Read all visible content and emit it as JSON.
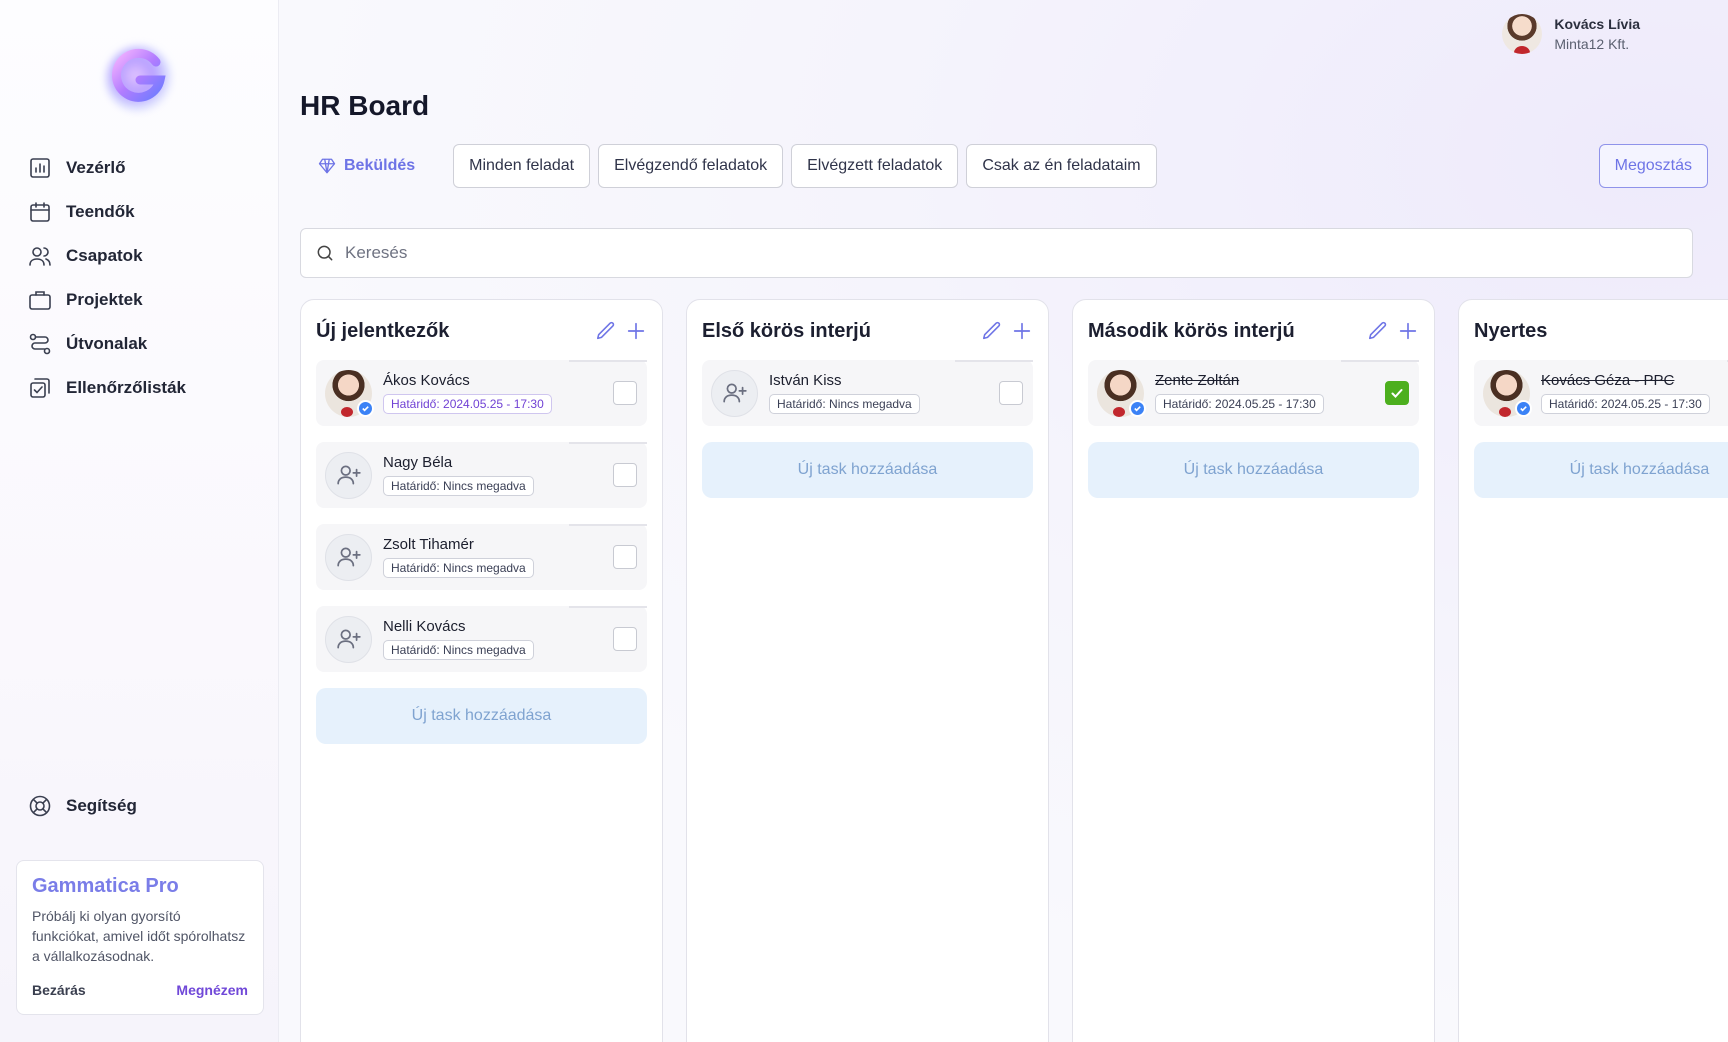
{
  "user": {
    "name": "Kovács Lívia",
    "company": "Minta12 Kft."
  },
  "sidebar": {
    "items": [
      {
        "label": "Vezérlő",
        "icon": "chart-icon"
      },
      {
        "label": "Teendők",
        "icon": "calendar-icon"
      },
      {
        "label": "Csapatok",
        "icon": "users-icon"
      },
      {
        "label": "Projektek",
        "icon": "briefcase-icon"
      },
      {
        "label": "Útvonalak",
        "icon": "route-icon"
      },
      {
        "label": "Ellenőrzőlisták",
        "icon": "checklist-icon"
      }
    ],
    "help_label": "Segítség",
    "promo": {
      "title": "Gammatica Pro",
      "text": "Próbálj ki olyan gyorsító funkciókat, amivel időt spórolhatsz a vállalkozásodnak.",
      "close_label": "Bezárás",
      "cta_label": "Megnézem"
    }
  },
  "page": {
    "title": "HR Board"
  },
  "toolbar": {
    "submit_label": "Beküldés",
    "filters": [
      "Minden feladat",
      "Elvégzendő feladatok",
      "Elvégzett feladatok",
      "Csak az én feladataim"
    ],
    "share_label": "Megosztás"
  },
  "search": {
    "placeholder": "Keresés",
    "value": ""
  },
  "columns": [
    {
      "title": "Új jelentkezők",
      "add_label": "Új task hozzáadása",
      "cards": [
        {
          "name": "Ákos Kovács",
          "deadline": "Határidő: 2024.05.25 - 17:30",
          "avatar": "photo",
          "done": false
        },
        {
          "name": "Nagy Béla",
          "deadline": "Határidő: Nincs megadva",
          "avatar": "placeholder",
          "done": false
        },
        {
          "name": "Zsolt Tihamér",
          "deadline": "Határidő: Nincs megadva",
          "avatar": "placeholder",
          "done": false
        },
        {
          "name": "Nelli Kovács",
          "deadline": "Határidő: Nincs megadva",
          "avatar": "placeholder",
          "done": false
        }
      ]
    },
    {
      "title": "Első körös interjú",
      "add_label": "Új task hozzáadása",
      "cards": [
        {
          "name": "István Kiss",
          "deadline": "Határidő: Nincs megadva",
          "avatar": "placeholder",
          "done": false
        }
      ]
    },
    {
      "title": "Második körös interjú",
      "add_label": "Új task hozzáadása",
      "cards": [
        {
          "name": "Zente Zoltán",
          "deadline": "Határidő: 2024.05.25 - 17:30",
          "avatar": "photo",
          "done": true
        }
      ]
    },
    {
      "title": "Nyertes",
      "add_label": "Új task hozzáadása",
      "cards": [
        {
          "name": "Kovács Géza - PPC",
          "deadline": "Határidő: 2024.05.25 - 17:30",
          "avatar": "photo",
          "done": true
        }
      ]
    }
  ],
  "colors": {
    "accent": "#6e74e6",
    "checked": "#4caf1e",
    "deadline_highlight": "#7041d4",
    "add_task_bg": "#e6f1fc"
  }
}
